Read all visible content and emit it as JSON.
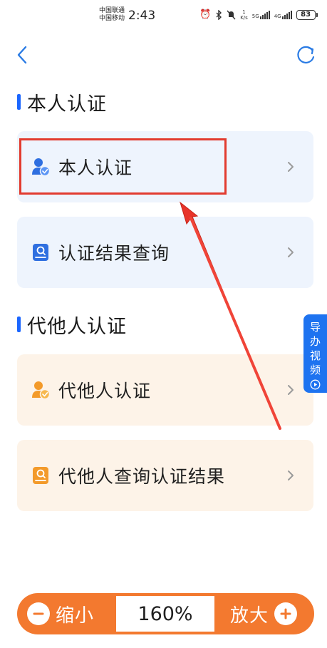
{
  "status_bar": {
    "carrier_1": "中国联通",
    "carrier_2": "中国移动",
    "time": "2:43",
    "speed_value": "1",
    "speed_unit": "K/s",
    "network_1": "5G",
    "network_2": "4G",
    "battery": "83"
  },
  "nav": {
    "back_icon": "chevron-left-icon",
    "refresh_icon": "refresh-icon"
  },
  "self_section": {
    "title": "本人认证",
    "items": [
      {
        "label": "本人认证",
        "icon": "user-check-icon"
      },
      {
        "label": "认证结果查询",
        "icon": "document-search-icon"
      }
    ]
  },
  "proxy_section": {
    "title": "代他人认证",
    "items": [
      {
        "label": "代他人认证",
        "icon": "user-check-icon"
      },
      {
        "label": "代他人查询认证结果",
        "icon": "document-search-icon"
      }
    ]
  },
  "guide_tab": {
    "chars": [
      "导",
      "办",
      "视",
      "频"
    ],
    "icon": "play-circle-icon"
  },
  "zoom": {
    "zoom_out_label": "缩小",
    "level": "160%",
    "zoom_in_label": "放大"
  },
  "colors": {
    "accent_blue": "#1a66ff",
    "orange": "#f3792f",
    "highlight_red": "#e23b2f",
    "card_blue_bg": "#eef4fd",
    "card_orange_bg": "#fdf3e8"
  }
}
